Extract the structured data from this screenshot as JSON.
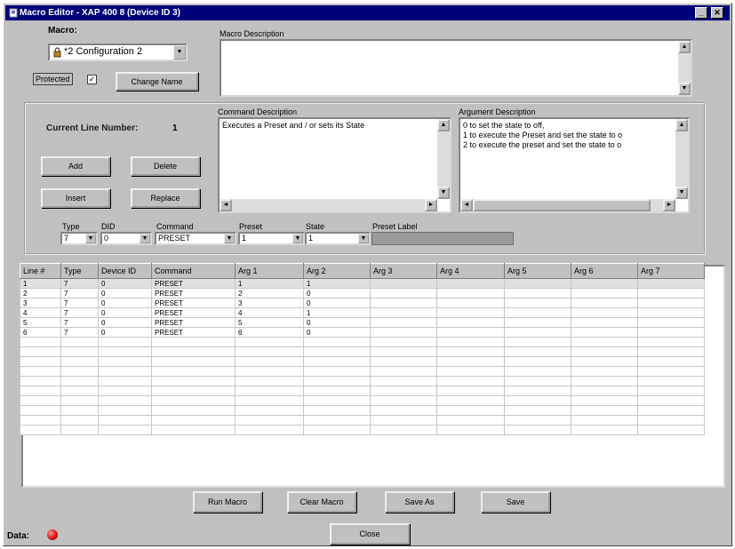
{
  "window": {
    "title": "Macro Editor - XAP 400 8 (Device ID 3)",
    "minimize": "_",
    "close": "✕"
  },
  "macro": {
    "label": "Macro:",
    "selected": "*2 Configuration 2",
    "protected_label": "Protected",
    "protected_checked": true,
    "change_name_button": "Change Name"
  },
  "macro_description": {
    "label": "Macro Description",
    "value": ""
  },
  "current_line": {
    "label": "Current Line Number:",
    "value": "1"
  },
  "buttons": {
    "add": "Add",
    "delete": "Delete",
    "insert": "Insert",
    "replace": "Replace"
  },
  "command_description": {
    "label": "Command Description",
    "text": "Executes a Preset and / or sets its State"
  },
  "argument_description": {
    "label": "Argument Description",
    "lines": [
      "0 to set the state to off,",
      "1 to execute the Preset and set the state to o",
      "2 to execute the preset and set the state to o"
    ]
  },
  "editor": {
    "type_label": "Type",
    "did_label": "DID",
    "command_label": "Command",
    "preset_label": "Preset",
    "state_label": "State",
    "preset_label_label": "Preset Label",
    "type_value": "7",
    "did_value": "0",
    "command_value": "PRESET",
    "preset_value": "1",
    "state_value": "1",
    "preset_label_value": ""
  },
  "table": {
    "columns": [
      "Line #",
      "Type",
      "Device ID",
      "Command",
      "Arg 1",
      "Arg 2",
      "Arg 3",
      "Arg 4",
      "Arg 5",
      "Arg 6",
      "Arg 7"
    ],
    "rows": [
      [
        "1",
        "7",
        "0",
        "PRESET",
        "1",
        "1",
        "",
        "",
        "",
        "",
        ""
      ],
      [
        "2",
        "7",
        "0",
        "PRESET",
        "2",
        "0",
        "",
        "",
        "",
        "",
        ""
      ],
      [
        "3",
        "7",
        "0",
        "PRESET",
        "3",
        "0",
        "",
        "",
        "",
        "",
        ""
      ],
      [
        "4",
        "7",
        "0",
        "PRESET",
        "4",
        "1",
        "",
        "",
        "",
        "",
        ""
      ],
      [
        "5",
        "7",
        "0",
        "PRESET",
        "5",
        "0",
        "",
        "",
        "",
        "",
        ""
      ],
      [
        "6",
        "7",
        "0",
        "PRESET",
        "6",
        "0",
        "",
        "",
        "",
        "",
        ""
      ]
    ],
    "empty_rows": 10
  },
  "footer": {
    "run_macro": "Run Macro",
    "clear_macro": "Clear Macro",
    "save_as": "Save As",
    "save": "Save",
    "close": "Close",
    "data_label": "Data:"
  },
  "colors": {
    "titlebar": "#00007b",
    "face": "#c0c0c0",
    "data_led": "#e01010"
  }
}
